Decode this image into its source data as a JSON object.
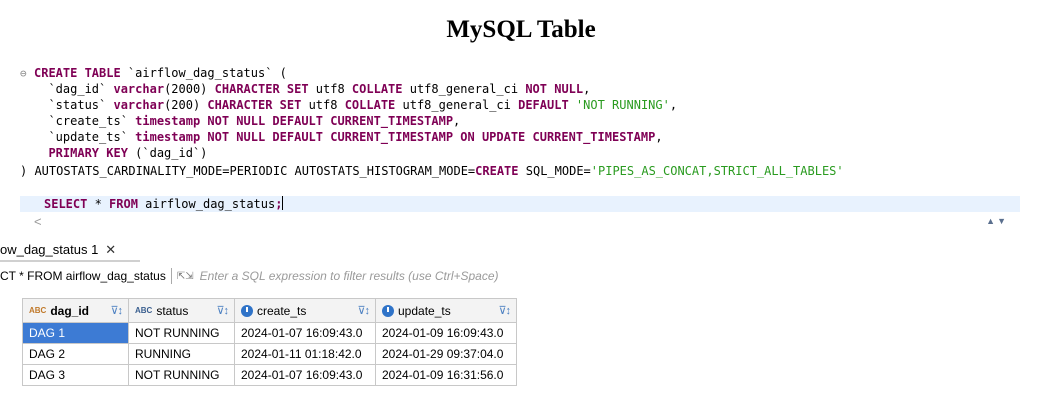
{
  "page": {
    "title": "MySQL Table"
  },
  "editor": {
    "fold_icon": "⊖",
    "lines": [
      [
        {
          "t": "CREATE TABLE ",
          "c": "kw"
        },
        {
          "t": "`airflow_dag_status`",
          "c": "id"
        },
        {
          "t": " (",
          "c": "pl"
        }
      ],
      [
        {
          "t": "  `dag_id` ",
          "c": "id"
        },
        {
          "t": "varchar",
          "c": "kw"
        },
        {
          "t": "(2000) ",
          "c": "pl"
        },
        {
          "t": "CHARACTER SET",
          "c": "kw"
        },
        {
          "t": " utf8 ",
          "c": "pl"
        },
        {
          "t": "COLLATE",
          "c": "kw"
        },
        {
          "t": " utf8_general_ci ",
          "c": "pl"
        },
        {
          "t": "NOT NULL",
          "c": "kw"
        },
        {
          "t": ",",
          "c": "pl"
        }
      ],
      [
        {
          "t": "  `status` ",
          "c": "id"
        },
        {
          "t": "varchar",
          "c": "kw"
        },
        {
          "t": "(200) ",
          "c": "pl"
        },
        {
          "t": "CHARACTER SET",
          "c": "kw"
        },
        {
          "t": " utf8 ",
          "c": "pl"
        },
        {
          "t": "COLLATE",
          "c": "kw"
        },
        {
          "t": " utf8_general_ci ",
          "c": "pl"
        },
        {
          "t": "DEFAULT",
          "c": "kw"
        },
        {
          "t": " ",
          "c": "pl"
        },
        {
          "t": "'NOT RUNNING'",
          "c": "str"
        },
        {
          "t": ",",
          "c": "pl"
        }
      ],
      [
        {
          "t": "  `create_ts` ",
          "c": "id"
        },
        {
          "t": "timestamp NOT NULL DEFAULT CURRENT_TIMESTAMP",
          "c": "kw"
        },
        {
          "t": ",",
          "c": "pl"
        }
      ],
      [
        {
          "t": "  `update_ts` ",
          "c": "id"
        },
        {
          "t": "timestamp NOT NULL DEFAULT CURRENT_TIMESTAMP ON UPDATE CURRENT_TIMESTAMP",
          "c": "kw"
        },
        {
          "t": ",",
          "c": "pl"
        }
      ],
      [
        {
          "t": "  PRIMARY KEY",
          "c": "kw"
        },
        {
          "t": " (`dag_id`)",
          "c": "id"
        }
      ],
      [
        {
          "t": ") AUTOSTATS_CARDINALITY_MODE=PERIODIC AUTOSTATS_HISTOGRAM_MODE=",
          "c": "pl"
        },
        {
          "t": "CREATE",
          "c": "kw"
        },
        {
          "t": " SQL_MODE=",
          "c": "pl"
        },
        {
          "t": "'PIPES_AS_CONCAT,STRICT_ALL_TABLES'",
          "c": "str"
        }
      ],
      [],
      [
        {
          "t": "SELECT",
          "c": "kw"
        },
        {
          "t": " * ",
          "c": "pl"
        },
        {
          "t": "FROM",
          "c": "kw"
        },
        {
          "t": " airflow_dag_status",
          "c": "pl"
        },
        {
          "t": ";",
          "c": "kw"
        }
      ]
    ]
  },
  "scroll": {
    "left_arrow": "<",
    "arrows": "▲▼"
  },
  "result_tab": {
    "label": "ow_dag_status 1",
    "close": "✕"
  },
  "filter": {
    "query": "CT * FROM airflow_dag_status",
    "expand_icon": "⇱⇲",
    "placeholder": "Enter a SQL expression to filter results (use Ctrl+Space)"
  },
  "table": {
    "columns": [
      {
        "type": "ABC",
        "label": "dag_id"
      },
      {
        "type": "ABC",
        "label": "status"
      },
      {
        "type": "clock",
        "label": "create_ts"
      },
      {
        "type": "clock",
        "label": "update_ts"
      }
    ],
    "header_controls": "⊽↕",
    "rows": [
      [
        "DAG 1",
        "NOT RUNNING",
        "2024-01-07 16:09:43.0",
        "2024-01-09 16:09:43.0"
      ],
      [
        "DAG 2",
        "RUNNING",
        "2024-01-11 01:18:42.0",
        "2024-01-29 09:37:04.0"
      ],
      [
        "DAG 3",
        "NOT RUNNING",
        "2024-01-07 16:09:43.0",
        "2024-01-09 16:31:56.0"
      ]
    ]
  }
}
